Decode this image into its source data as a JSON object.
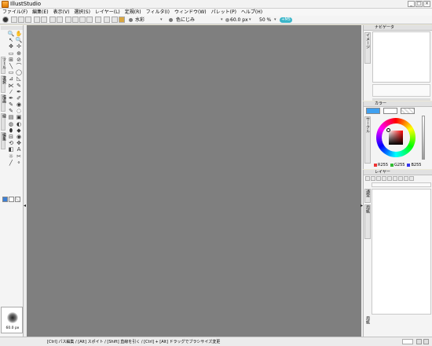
{
  "window": {
    "title": "IllustStudio",
    "min_glyph": "_",
    "max_glyph": "□",
    "close_glyph": "×"
  },
  "menu": {
    "items": [
      "ファイル(F)",
      "編集(E)",
      "表示(V)",
      "選択(S)",
      "レイヤー(L)",
      "定規(R)",
      "フィルタ(I)",
      "ウィンドウ(W)",
      "パレット(P)",
      "ヘルプ(H)"
    ]
  },
  "toolbar": {
    "brush_name": "水彩",
    "blend_name": "色にじみ",
    "brush_size": "60.0 px",
    "opacity": "50 %",
    "pill_label": "+M5",
    "dropdown_glyph": "▾"
  },
  "tool_panel": {
    "tools": [
      "🔍",
      "✋",
      "↖",
      "🔍",
      "✥",
      "✢",
      "▭",
      "⊕",
      "⊞",
      "⊘",
      "╲",
      "⌒",
      "▭",
      "◯",
      "⊿",
      "◺",
      "⋉",
      "✎",
      "⁄",
      "✒",
      "✒",
      "✐",
      "✎",
      "◉",
      "✎",
      "◌",
      "▤",
      "▣",
      "◍",
      "◐",
      "⬮",
      "◆",
      "⊟",
      "◉",
      "⟲",
      "✥",
      "◧",
      "A",
      "☼",
      "✂",
      "╱",
      "⚬"
    ],
    "category_tabs": [
      "ツール",
      "選択",
      "描画",
      "線",
      "編集"
    ],
    "brush_preview_size": "60.0 px",
    "colors": {
      "main": "#3b7fd6",
      "sub": "#ffffff"
    }
  },
  "navigator": {
    "title": "ナビゲータ",
    "side_tab": "イメージ"
  },
  "color_panel": {
    "title": "カラー",
    "side_tab": "サークル",
    "main_color": "#3fa0f0",
    "sub_color": "#ffffff",
    "r": "R255",
    "g": "G255",
    "b": "B255"
  },
  "layer_panel": {
    "title": "レイヤー",
    "side_tabs": [
      "通常",
      "用紙"
    ],
    "bottom_label": "用紙"
  },
  "statusbar": {
    "hint": "[Ctrl] パス編集 / [Alt] スポイト / [Shift] 直線を引く / [Ctrl] + [Alt] ドラッグでブラシサイズ変更"
  }
}
